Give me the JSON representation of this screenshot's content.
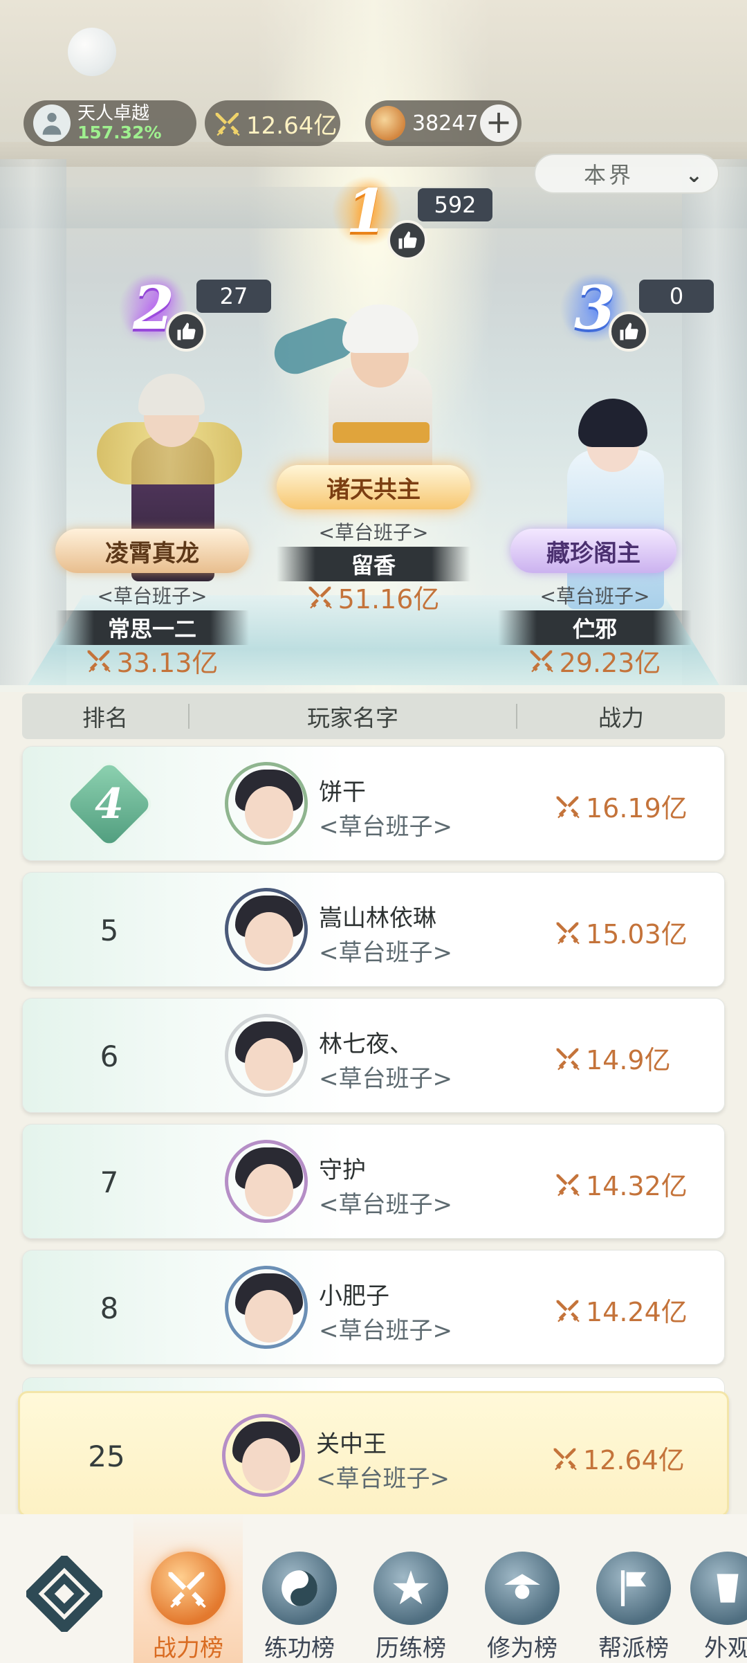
{
  "header": {
    "rank_title": "天人卓越",
    "rank_percent": "157.32%",
    "power": "12.64亿",
    "jade": "38247",
    "realm_select": "本界"
  },
  "podium": [
    {
      "rank": "1",
      "likes": "592",
      "title": "诸天共主",
      "guild": "<草台班子>",
      "name": "留香",
      "power": "51.16亿"
    },
    {
      "rank": "2",
      "likes": "27",
      "title": "凌霄真龙",
      "guild": "<草台班子>",
      "name": "常思一二",
      "power": "33.13亿"
    },
    {
      "rank": "3",
      "likes": "0",
      "title": "藏珍阁主",
      "guild": "<草台班子>",
      "name": "伫邪",
      "power": "29.23亿"
    }
  ],
  "table": {
    "headers": [
      "排名",
      "玩家名字",
      "战力"
    ],
    "rows": [
      {
        "rank": "4",
        "name": "饼干",
        "guild": "<草台班子>",
        "power": "16.19亿"
      },
      {
        "rank": "5",
        "name": "嵩山林依琳",
        "guild": "<草台班子>",
        "power": "15.03亿"
      },
      {
        "rank": "6",
        "name": "林七夜、",
        "guild": "<草台班子>",
        "power": "14.9亿"
      },
      {
        "rank": "7",
        "name": "守护",
        "guild": "<草台班子>",
        "power": "14.32亿"
      },
      {
        "rank": "8",
        "name": "小肥子",
        "guild": "<草台班子>",
        "power": "14.24亿"
      }
    ],
    "self": {
      "rank": "25",
      "name": "关中王",
      "guild": "<草台班子>",
      "power": "12.64亿"
    }
  },
  "nav": {
    "items": [
      "战力榜",
      "练功榜",
      "历练榜",
      "修为榜",
      "帮派榜",
      "外观"
    ],
    "active": "战力榜"
  },
  "colors": {
    "power_text": "#c4733a",
    "active_tab": "#d96c22",
    "rank1": "#ff9a28",
    "rank2": "#b45cf0",
    "rank3": "#5a86f2"
  }
}
